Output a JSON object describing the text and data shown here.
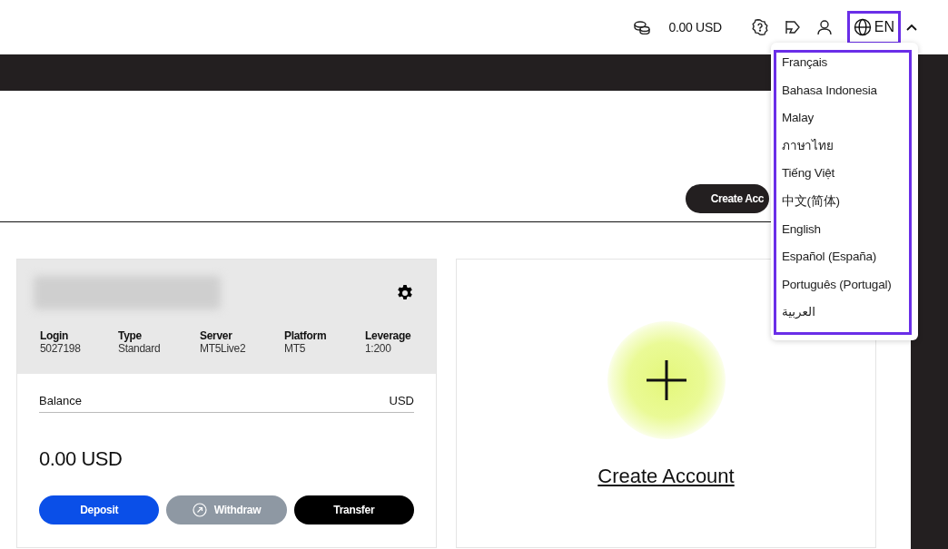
{
  "header": {
    "balance": "0.00 USD",
    "language": {
      "code": "EN",
      "expanded": true
    }
  },
  "language_menu": [
    "Français",
    "Bahasa Indonesia",
    "Malay",
    "ภาษาไทย",
    "Tiếng Việt",
    "中文(简体)",
    "English",
    "Español (España)",
    "Português (Portugal)",
    "العربية"
  ],
  "toolbar": {
    "create_button": "Create Acc"
  },
  "account_card": {
    "fields": [
      {
        "label": "Login",
        "value": "5027198"
      },
      {
        "label": "Type",
        "value": "Standard"
      },
      {
        "label": "Server",
        "value": "MT5Live2"
      },
      {
        "label": "Platform",
        "value": "MT5"
      },
      {
        "label": "Leverage",
        "value": "1:200"
      }
    ],
    "balance_label": "Balance",
    "currency": "USD",
    "amount": "0.00 USD",
    "actions": [
      {
        "label": "Deposit",
        "kind": "primary"
      },
      {
        "label": "Withdraw",
        "kind": "muted"
      },
      {
        "label": "Transfer",
        "kind": "dark"
      }
    ]
  },
  "new_account_card": {
    "label": "Create Account"
  }
}
